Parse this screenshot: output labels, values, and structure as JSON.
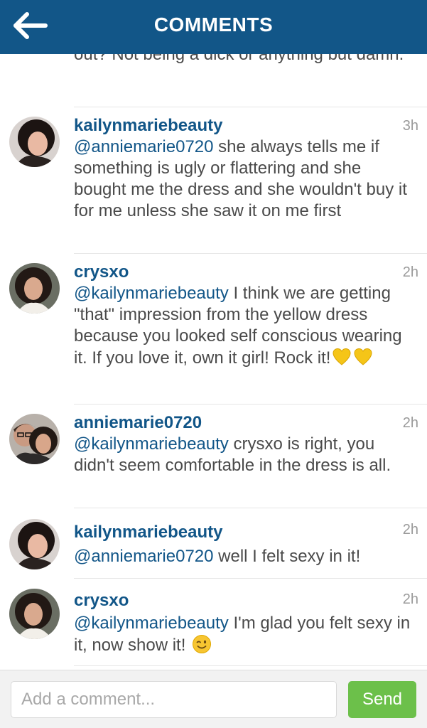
{
  "header": {
    "title": "COMMENTS",
    "back_icon": "arrow-left-icon"
  },
  "colors": {
    "header_bg": "#125688",
    "username": "#125688",
    "text": "#4a4a4a",
    "time": "#9a9a9a",
    "send_bg": "#6cc04a"
  },
  "partial_comment": {
    "text": "out? Not being a dick or anything but damn."
  },
  "comments": [
    {
      "username": "kailynmariebeauty",
      "time": "3h",
      "mention": "@anniemarie0720",
      "text": " she always tells me if something is ugly or flattering and she bought me the dress and she wouldn't buy it for me unless she saw it on me first"
    },
    {
      "username": "crysxo",
      "time": "2h",
      "mention": "@kailynmariebeauty",
      "text": " I think we are getting \"that\" impression from the yellow dress because you looked self conscious wearing it. If you love it, own it girl! Rock it!",
      "emoji": [
        "yellow-heart-emoji",
        "yellow-heart-emoji"
      ]
    },
    {
      "username": "anniemarie0720",
      "time": "2h",
      "mention": "@kailynmariebeauty",
      "text": " crysxo is right, you didn't seem comfortable in the dress is all."
    },
    {
      "username": "kailynmariebeauty",
      "time": "2h",
      "mention": "@anniemarie0720",
      "text": " well I felt sexy in it!"
    },
    {
      "username": "crysxo",
      "time": "2h",
      "mention": "@kailynmariebeauty",
      "text": " I'm glad you felt sexy in it, now show it! ",
      "emoji": [
        "winking-face-emoji"
      ]
    }
  ],
  "footer": {
    "input_placeholder": "Add a comment...",
    "input_value": "",
    "send_label": "Send"
  }
}
